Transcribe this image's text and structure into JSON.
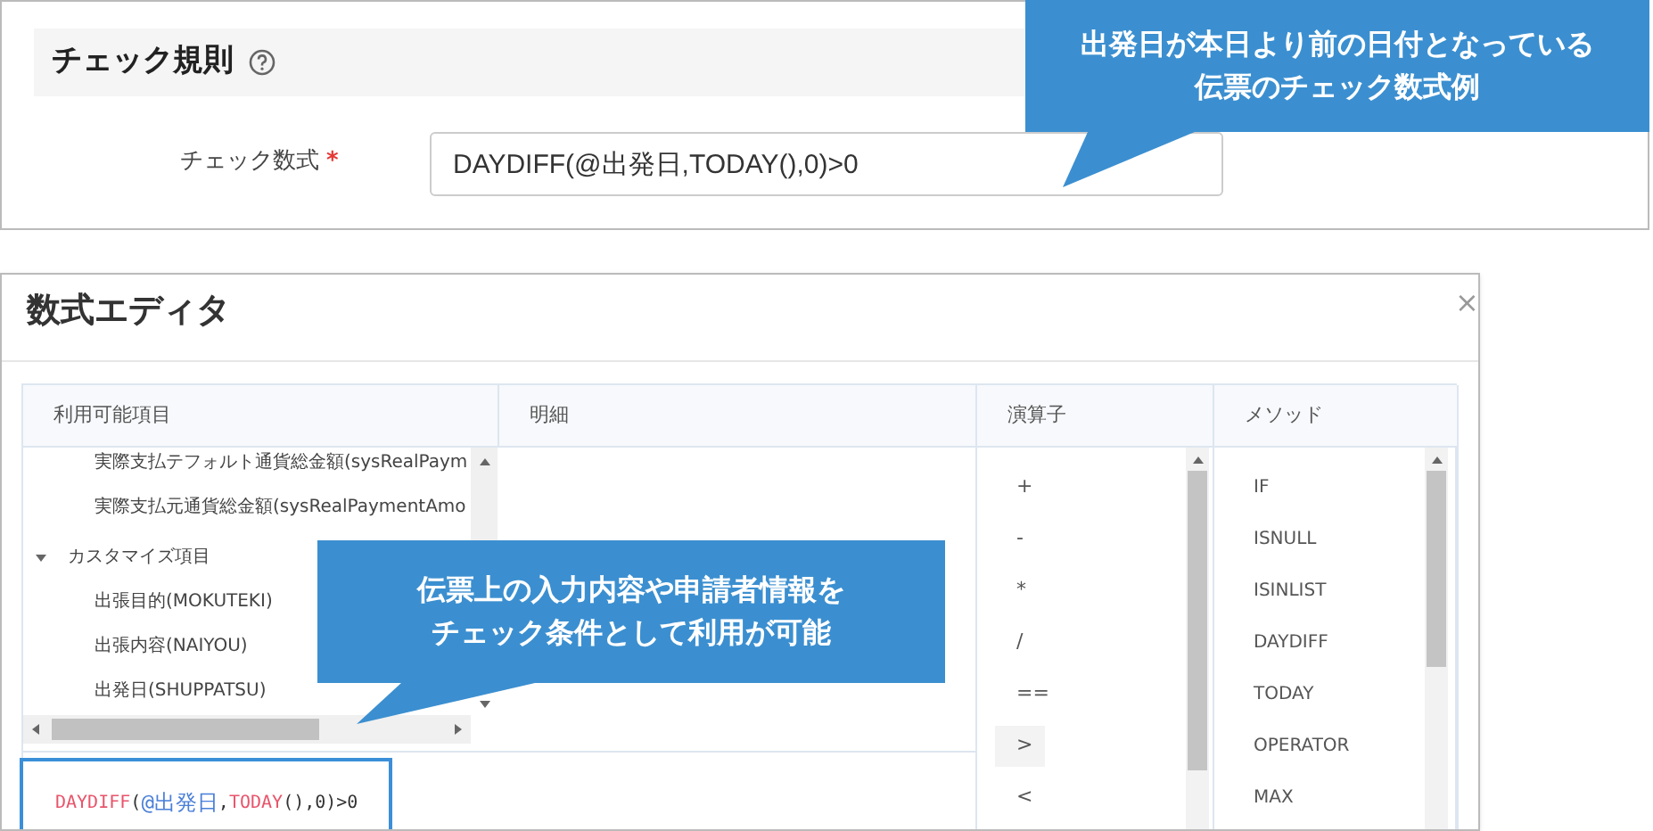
{
  "rule_panel": {
    "section_title": "チェック規則",
    "field_label": "チェック数式",
    "required_mark": "*",
    "formula_value": "DAYDIFF(@出発日,TODAY(),0)>0"
  },
  "callouts": [
    {
      "lines": [
        "出発日が本日より前の日付となっている",
        "伝票のチェック数式例"
      ]
    },
    {
      "lines": [
        "伝票上の入力内容や申請者情報を",
        "チェック条件として利用が可能"
      ]
    }
  ],
  "editor": {
    "title": "数式エディタ",
    "close": "×",
    "columns": [
      "利用可能項目",
      "明細",
      "演算子",
      "メソッド"
    ],
    "fields": [
      {
        "label": "実際支払テフォルト通貨総金額(sysRealPaym"
      },
      {
        "label": "実際支払元通貨総金額(sysRealPaymentAmo"
      },
      {
        "label": "カスタマイズ項目",
        "expanded": true,
        "children": [
          {
            "label": "出張目的(MOKUTEKI)"
          },
          {
            "label": "出張内容(NAIYOU)"
          },
          {
            "label": "出発日(SHUPPATSU)"
          }
        ]
      }
    ],
    "operators": [
      {
        "label": "+",
        "selected": false
      },
      {
        "label": "-",
        "selected": false
      },
      {
        "label": "*",
        "selected": false
      },
      {
        "label": "/",
        "selected": false
      },
      {
        "label": "==",
        "selected": false
      },
      {
        "label": ">",
        "selected": true
      },
      {
        "label": "<",
        "selected": false
      }
    ],
    "methods": [
      "IF",
      "ISNULL",
      "ISINLIST",
      "DAYDIFF",
      "TODAY",
      "OPERATOR",
      "MAX"
    ],
    "formula": [
      {
        "text": "DAYDIFF",
        "kind": "function"
      },
      {
        "text": "(",
        "kind": "symbol"
      },
      {
        "text": "@出発日",
        "kind": "field"
      },
      {
        "text": ",",
        "kind": "symbol"
      },
      {
        "text": "TODAY",
        "kind": "function"
      },
      {
        "text": "(),0)>0",
        "kind": "symbol"
      }
    ]
  }
}
